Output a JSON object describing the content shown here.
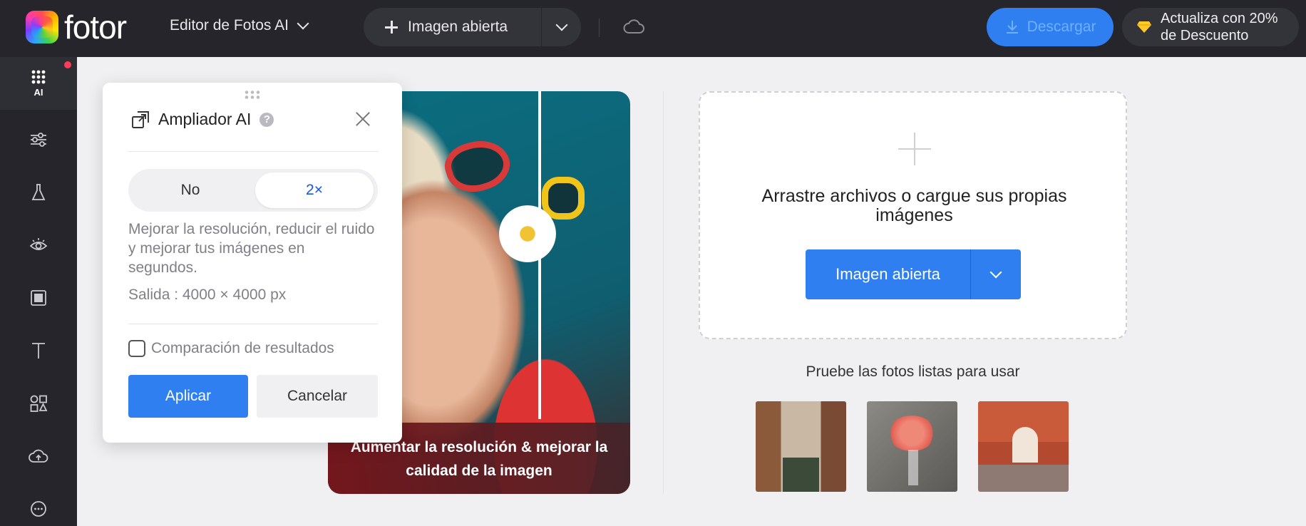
{
  "header": {
    "logo_text": "fotor",
    "mode_label": "Editor de Fotos AI",
    "open_button_label": "Imagen abierta",
    "download_label": "Descargar",
    "upgrade_line1": "Actualiza con 20%",
    "upgrade_line2": "de Descuento"
  },
  "rail": {
    "active_label": "AI",
    "items": [
      "ai-tools",
      "adjust",
      "beauty",
      "eye",
      "frame",
      "text",
      "elements",
      "upload",
      "more"
    ]
  },
  "panel": {
    "title": "Ampliador AI",
    "help_glyph": "?",
    "option_no": "No",
    "option_2x": "2×",
    "selected_option": "2×",
    "description": "Mejorar la resolución, reducir el ruido y mejorar tus imágenes en segundos.",
    "output": "Salida : 4000 × 4000 px",
    "compare_label": "Comparación de resultados",
    "compare_checked": false,
    "apply_label": "Aplicar",
    "cancel_label": "Cancelar"
  },
  "preview": {
    "caption": "Aumentar la resolución & mejorar la calidad de la imagen"
  },
  "dropzone": {
    "text": "Arrastre archivos o cargue sus propias imágenes",
    "button_label": "Imagen abierta"
  },
  "samples": {
    "title": "Pruebe las fotos listas para usar",
    "items": [
      "venice-canal",
      "pink-flowers-vase",
      "red-archway"
    ]
  },
  "colors": {
    "topbar": "#25252b",
    "accent": "#2f7ff0",
    "selected_text": "#1b56e6",
    "notification": "#ff3b5c"
  }
}
